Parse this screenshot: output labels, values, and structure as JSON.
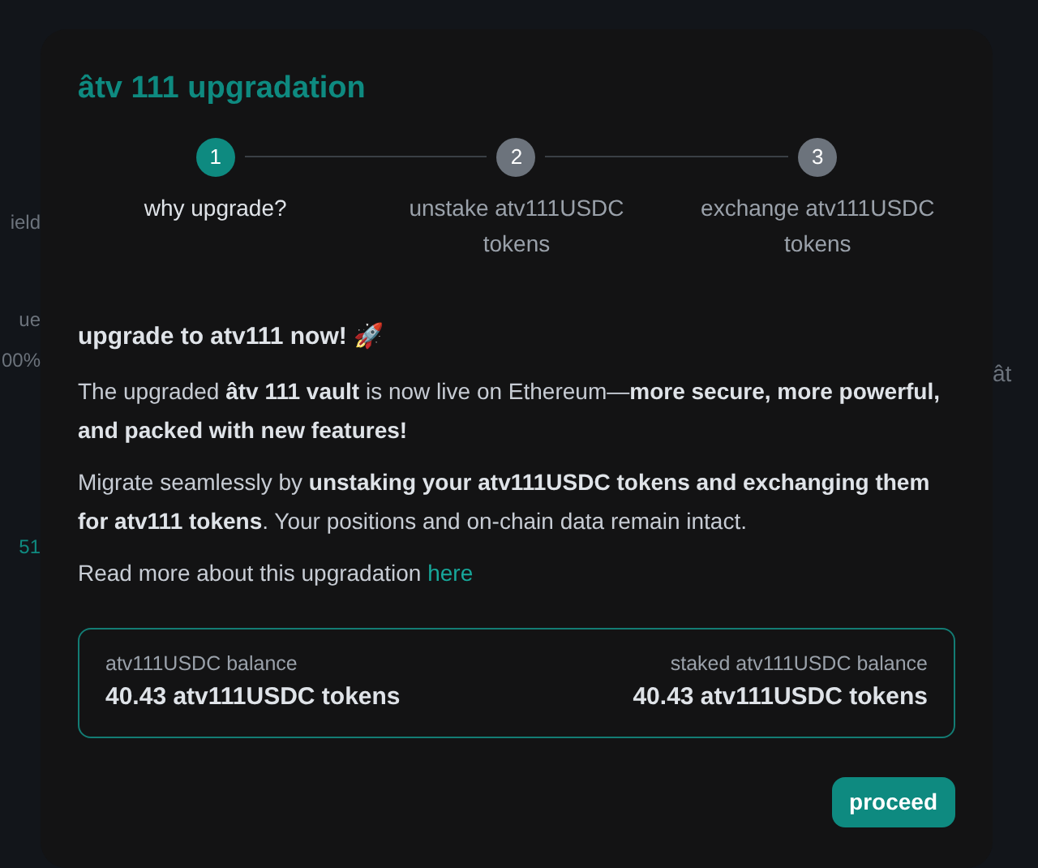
{
  "background": {
    "left_fragments": [
      "ield",
      "ue",
      "00%",
      "51"
    ],
    "right_fragments": [
      "ât"
    ]
  },
  "dialog": {
    "title": "âtv 111 upgradation",
    "steps": [
      {
        "number": "1",
        "label": "why upgrade?",
        "selected": true
      },
      {
        "number": "2",
        "label": "unstake atv111USDC tokens",
        "selected": false
      },
      {
        "number": "3",
        "label": "exchange atv111USDC tokens",
        "selected": false
      }
    ],
    "heading": "upgrade to atv111 now! 🚀",
    "paragraphs": [
      "The upgraded **âtv 111 vault** is now live on Ethereum—**more secure, more powerful, and packed with new features!**",
      "Migrate seamlessly by **unstaking your atv111USDC tokens and exchanging them for atv111 tokens**. Your positions and on-chain data remain intact."
    ],
    "read_more": {
      "text": "Read more about this upgradation",
      "link": "here"
    },
    "balances": [
      {
        "label": "atv111USDC balance",
        "value": "40.43 atv111USDC tokens"
      },
      {
        "label": "staked atv111USDC balance",
        "value": "40.43 atv111USDC tokens"
      }
    ],
    "button": "proceed"
  }
}
